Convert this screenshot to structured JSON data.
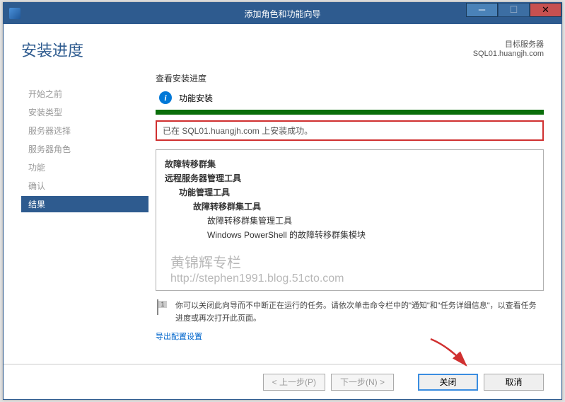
{
  "window": {
    "title": "添加角色和功能向导"
  },
  "header": {
    "page_title": "安装进度",
    "server_label": "目标服务器",
    "server_name": "SQL01.huangjh.com"
  },
  "steps": [
    {
      "label": "开始之前",
      "active": false
    },
    {
      "label": "安装类型",
      "active": false
    },
    {
      "label": "服务器选择",
      "active": false
    },
    {
      "label": "服务器角色",
      "active": false
    },
    {
      "label": "功能",
      "active": false
    },
    {
      "label": "确认",
      "active": false
    },
    {
      "label": "结果",
      "active": true
    }
  ],
  "progress": {
    "section_label": "查看安装进度",
    "status_text": "功能安装",
    "success_message": "已在 SQL01.huangjh.com 上安装成功。"
  },
  "features": [
    {
      "text": "故障转移群集",
      "indent": 0,
      "bold": true
    },
    {
      "text": "远程服务器管理工具",
      "indent": 0,
      "bold": true
    },
    {
      "text": "功能管理工具",
      "indent": 1,
      "bold": true
    },
    {
      "text": "故障转移群集工具",
      "indent": 2,
      "bold": true
    },
    {
      "text": "故障转移群集管理工具",
      "indent": 3,
      "bold": false
    },
    {
      "text": "Windows PowerShell 的故障转移群集模块",
      "indent": 3,
      "bold": false
    }
  ],
  "watermark": {
    "line1": "黄锦辉专栏",
    "line2": "http://stephen1991.blog.51cto.com"
  },
  "hint": {
    "text": "你可以关闭此向导而不中断正在运行的任务。请依次单击命令栏中的\"通知\"和\"任务详细信息\"，以查看任务进度或再次打开此页面。"
  },
  "export_link": "导出配置设置",
  "buttons": {
    "prev": "< 上一步(P)",
    "next": "下一步(N) >",
    "close": "关闭",
    "cancel": "取消"
  }
}
